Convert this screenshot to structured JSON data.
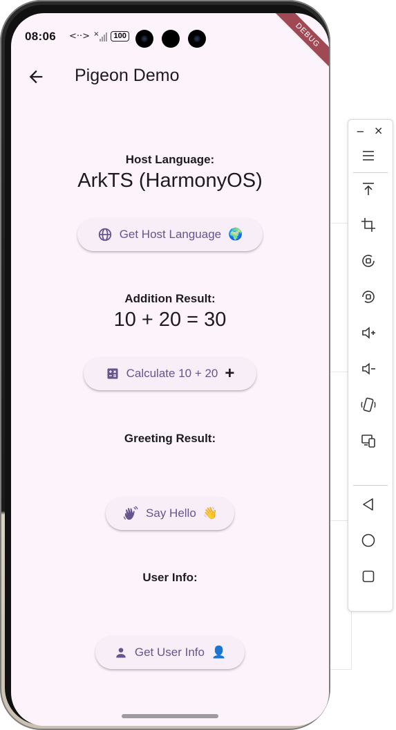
{
  "status_bar": {
    "time": "08:06",
    "data_icon": "<··>",
    "signal_mark": "×",
    "battery": "100"
  },
  "debug_banner": "DEBUG",
  "app_bar": {
    "title": "Pigeon Demo",
    "back_icon": "arrow-left-icon"
  },
  "sections": {
    "host_language": {
      "label": "Host Language:",
      "value": "ArkTS (HarmonyOS)",
      "button_label": "Get Host Language",
      "button_emoji": "🌍",
      "button_icon": "globe-icon"
    },
    "addition": {
      "label": "Addition Result:",
      "value": "10 + 20 = 30",
      "button_label": "Calculate 10 + 20",
      "button_emoji": "+",
      "button_icon": "calculator-icon"
    },
    "greeting": {
      "label": "Greeting Result:",
      "value": "",
      "button_label": "Say Hello",
      "button_emoji": "👋",
      "button_icon": "waving-hand-icon"
    },
    "user_info": {
      "label": "User Info:",
      "value": "",
      "button_label": "Get User Info",
      "button_emoji": "👤",
      "button_icon": "person-icon"
    }
  },
  "emulator_toolbar": {
    "minimize": "−",
    "close": "×",
    "items": [
      "menu-icon",
      "pin-top-icon",
      "crop-icon",
      "rotate-icon",
      "rotate-alt-icon",
      "volume-up-icon",
      "volume-down-icon",
      "shake-icon",
      "multi-device-icon",
      "back-nav-icon",
      "home-nav-icon",
      "recents-nav-icon"
    ]
  },
  "colors": {
    "screen_background": "#fdf4fb",
    "button_background": "#f7eef8",
    "button_text": "#65558f",
    "debug_ribbon": "#a04854"
  }
}
